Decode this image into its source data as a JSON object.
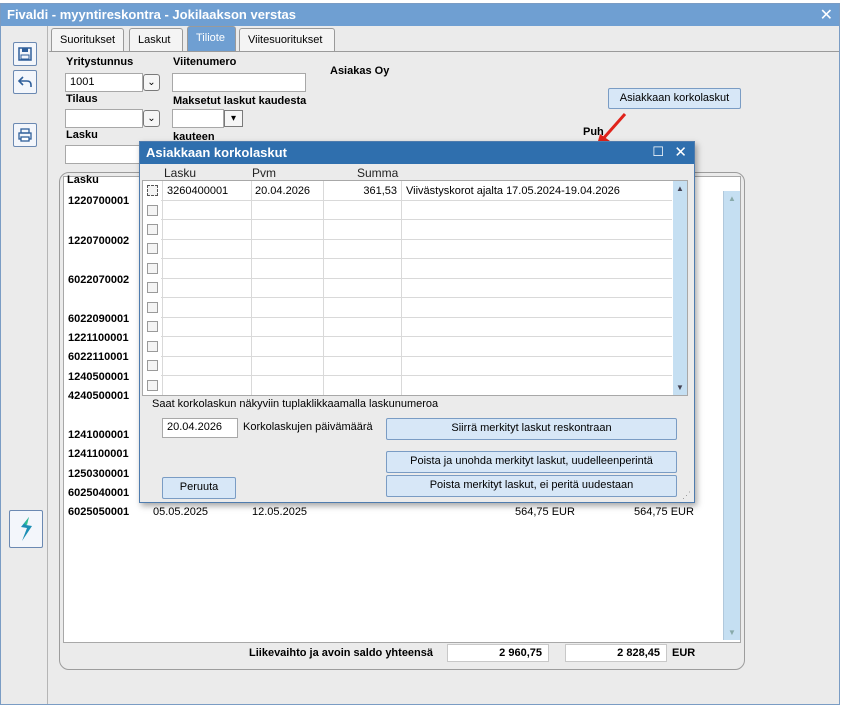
{
  "window": {
    "title": "Fivaldi - myyntireskontra - Jokilaakson verstas"
  },
  "tabs": [
    {
      "label": "Suoritukset"
    },
    {
      "label": "Laskut"
    },
    {
      "label": "Tiliote"
    },
    {
      "label": "Viitesuoritukset"
    }
  ],
  "form": {
    "yritystunnus_label": "Yritystunnus",
    "yritystunnus_value": "1001",
    "viitenumero_label": "Viitenumero",
    "viitenumero_value": "",
    "tilaus_label": "Tilaus",
    "maksetut_label": "Maksetut laskut kaudesta",
    "kauteen_label": "kauteen",
    "lasku_label": "Lasku",
    "asiakas": "Asiakas Oy",
    "puh_label": "Puh",
    "korkolaskut_button": "Asiakkaan korkolaskut"
  },
  "table": {
    "lasku_header": "Lasku",
    "rows": [
      {
        "lasku": "1220700001"
      },
      {
        "lasku": "1220700002"
      },
      {
        "lasku": "6022070002"
      },
      {
        "lasku": "6022090001"
      },
      {
        "lasku": "1221100001"
      },
      {
        "lasku": "6022110001"
      },
      {
        "lasku": "1240500001"
      },
      {
        "lasku": "4240500001"
      },
      {
        "lasku": "1241000001"
      },
      {
        "lasku": "1241100001"
      },
      {
        "lasku": "1250300001"
      },
      {
        "lasku": "6025040001"
      },
      {
        "lasku": "6025050001",
        "date1": "05.05.2025",
        "date2": "12.05.2025",
        "amount1": "564,75 EUR",
        "amount2": "564,75 EUR"
      }
    ],
    "total_label": "Liikevaihto ja avoin saldo yhteensä",
    "total_liikevaihto": "2 960,75",
    "total_saldo": "2 828,45",
    "total_currency": "EUR"
  },
  "dialog": {
    "title": "Asiakkaan korkolaskut",
    "headers": {
      "lasku": "Lasku",
      "pvm": "Pvm",
      "summa": "Summa"
    },
    "rows": [
      {
        "lasku": "3260400001",
        "pvm": "20.04.2026",
        "summa": "361,53",
        "selite": "Viivästyskorot ajalta 17.05.2024-19.04.2026"
      }
    ],
    "hint": "Saat korkolaskun näkyviin tuplaklikkaamalla laskunumeroa",
    "date_value": "20.04.2026",
    "date_label": "Korkolaskujen päivämäärä",
    "btn_siirra": "Siirrä merkityt laskut reskontraan",
    "btn_poista_unohda": "Poista ja unohda merkityt laskut, uudelleenperintä",
    "btn_poista": "Poista merkityt laskut, ei peritä uudestaan",
    "btn_peruuta": "Peruuta"
  },
  "colors": {
    "accent": "#6f9fd2",
    "dialog_title": "#2f6fae",
    "button_bg": "#d7e7f7",
    "arrow": "#e0231b"
  }
}
